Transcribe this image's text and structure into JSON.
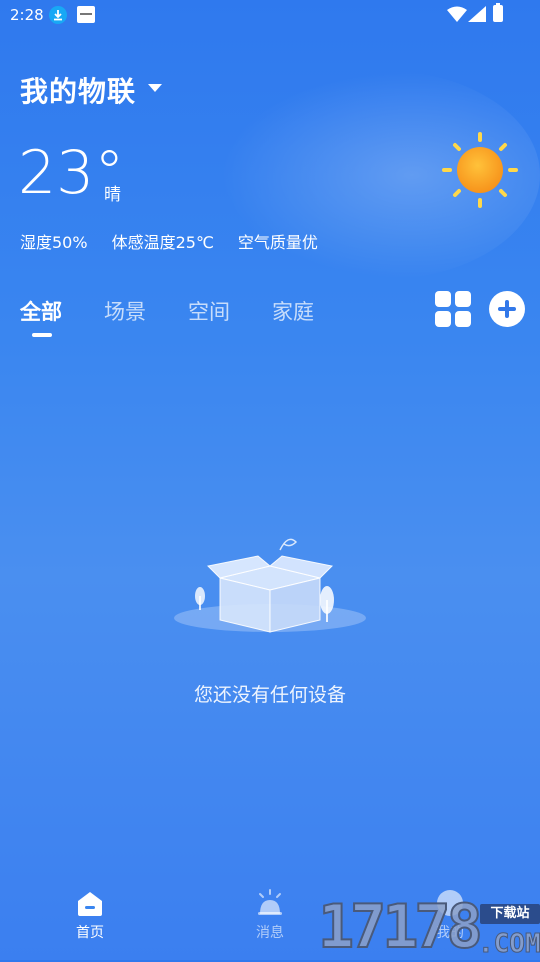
{
  "status_bar": {
    "time": "2:28",
    "icons": [
      "download-icon",
      "notification-icon",
      "wifi-icon",
      "signal-icon",
      "battery-icon"
    ]
  },
  "header": {
    "home_name": "我的物联"
  },
  "weather": {
    "temperature": "23°",
    "condition": "晴",
    "humidity": "湿度50%",
    "feels_like": "体感温度25℃",
    "air_quality": "空气质量优",
    "icon": "sun-icon"
  },
  "tabs": [
    {
      "label": "全部",
      "active": true
    },
    {
      "label": "场景",
      "active": false
    },
    {
      "label": "空间",
      "active": false
    },
    {
      "label": "家庭",
      "active": false
    }
  ],
  "toolbar": {
    "grid_icon": "grid-view-icon",
    "add_icon": "add-icon"
  },
  "empty_state": {
    "message": "您还没有任何设备",
    "icon": "empty-box-icon"
  },
  "bottom_nav": [
    {
      "label": "首页",
      "icon": "home-icon",
      "active": true
    },
    {
      "label": "消息",
      "icon": "bell-icon",
      "active": false
    },
    {
      "label": "我的",
      "icon": "user-icon",
      "active": false
    }
  ],
  "watermark": {
    "number": "17178",
    "badge": "下载站",
    "domain": ".COM"
  },
  "colors": {
    "background": "#3a86f0",
    "sun": "#f7a21b",
    "accent": "#3278e9"
  }
}
